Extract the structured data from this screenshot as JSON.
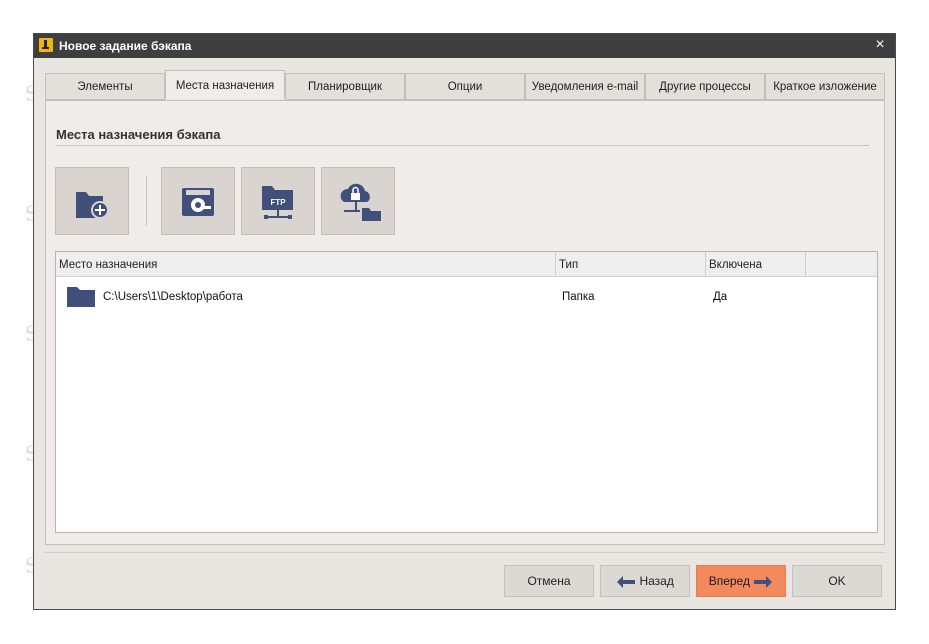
{
  "window": {
    "title": "Новое задание бэкапа",
    "close_glyph": "×"
  },
  "tabs": [
    {
      "label": "Элементы"
    },
    {
      "label": "Места назначения"
    },
    {
      "label": "Планировщик"
    },
    {
      "label": "Опции"
    },
    {
      "label": "Уведомления e-mail"
    },
    {
      "label": "Другие процессы"
    },
    {
      "label": "Краткое изложение"
    }
  ],
  "section": {
    "title": "Места назначения бэкапа"
  },
  "toolbar": {
    "buttons": [
      {
        "icon": "add-folder-icon"
      },
      {
        "icon": "disk-icon"
      },
      {
        "icon": "ftp-icon"
      },
      {
        "icon": "cloud-lock-icon"
      }
    ]
  },
  "table": {
    "columns": [
      "Место назначения",
      "Тип",
      "Включена"
    ],
    "rows": [
      {
        "destination": "C:\\Users\\1\\Desktop\\работа",
        "type": "Папка",
        "enabled": "Да",
        "icon": "folder-icon"
      }
    ]
  },
  "buttons": {
    "cancel": "Отмена",
    "back": "Назад",
    "next": "Вперед",
    "ok": "OK"
  },
  "colors": {
    "accent": "#f28a5e",
    "titlebar": "#3f3f3f",
    "icon_blue": "#41507a"
  },
  "watermark": "Soringpcrepair.Com"
}
